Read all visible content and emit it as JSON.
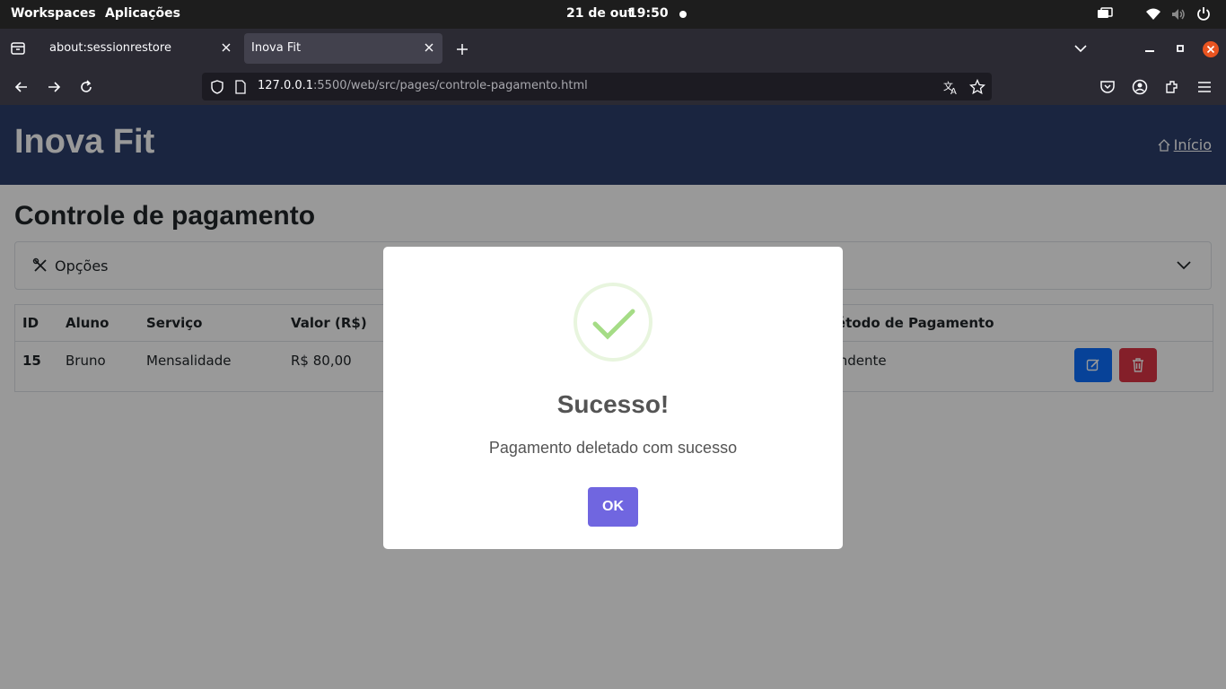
{
  "system_bar": {
    "workspaces": "Workspaces",
    "applications": "Aplicações",
    "date": "21 de out",
    "time": "19:50"
  },
  "browser": {
    "tabs": [
      {
        "label": "about:sessionrestore",
        "active": false
      },
      {
        "label": "Inova Fit",
        "active": true
      }
    ],
    "url_host": "127.0.0.1",
    "url_rest": ":5500/web/src/pages/controle-pagamento.html"
  },
  "header": {
    "brand": "Inova Fit",
    "home_link": "Início"
  },
  "main": {
    "page_title": "Controle de pagamento",
    "options_label": "Opções",
    "table": {
      "columns": [
        "ID",
        "Aluno",
        "Serviço",
        "Valor (R$)",
        "Método de Pagamento"
      ],
      "rows": [
        {
          "id": "15",
          "aluno": "Bruno",
          "servico": "Mensalidade",
          "valor": "R$ 80,00",
          "metodo": "Pendente"
        }
      ]
    }
  },
  "modal": {
    "icon": "success-check-icon",
    "title": "Sucesso!",
    "text": "Pagamento deletado com sucesso",
    "ok_label": "OK"
  },
  "colors": {
    "header_bg": "#2c3e6b",
    "edit_button": "#0d6efd",
    "delete_button": "#dc3545",
    "ok_button": "#7066e0",
    "success": "#a5dc86"
  }
}
